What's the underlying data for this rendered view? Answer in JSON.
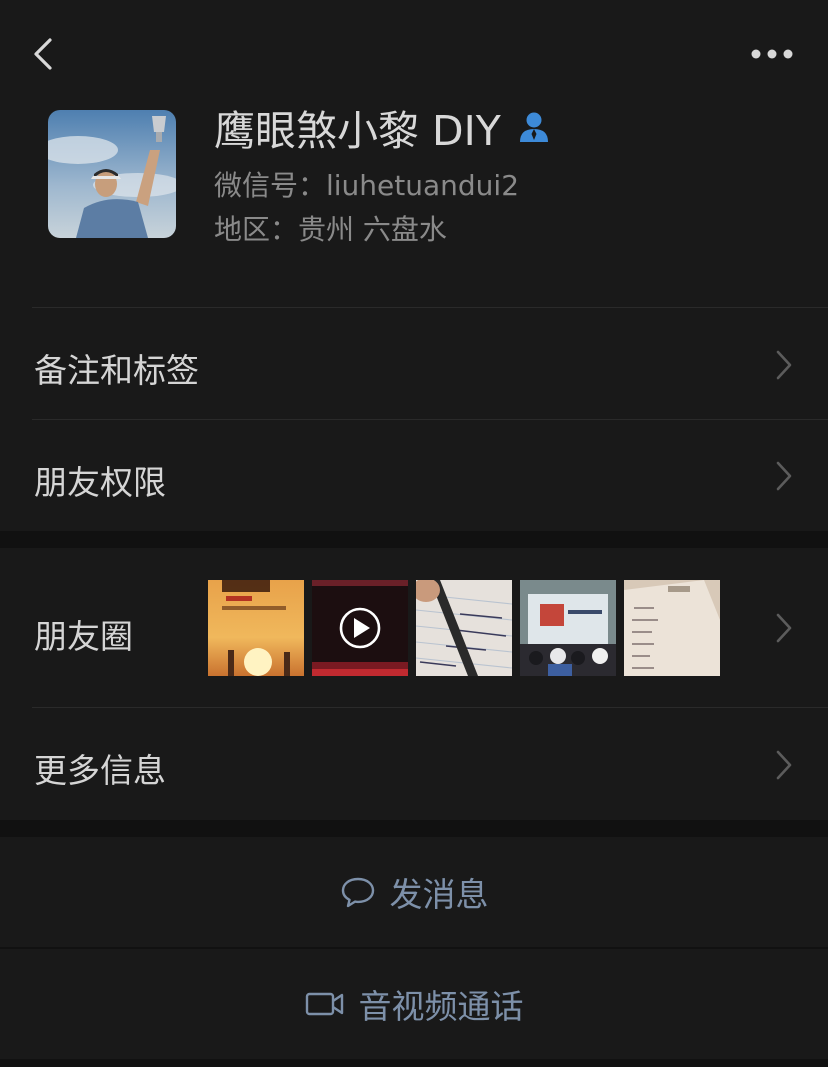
{
  "nav": {
    "back_icon": "chevron-left-icon",
    "more_icon": "more-dots-icon"
  },
  "profile": {
    "name": "鹰眼煞小黎 DIY",
    "wechat_id": "微信号：liuhetuandui2",
    "region": "地区：贵州 六盘水",
    "badge_icon": "person-icon"
  },
  "menu": {
    "remarks_tags": "备注和标签",
    "friend_permissions": "朋友权限",
    "moments": "朋友圈",
    "more_info": "更多信息"
  },
  "actions": {
    "send_message": "发消息",
    "av_call": "音视频通话"
  },
  "colors": {
    "background": "#111111",
    "cell": "#191919",
    "primary_text": "#d5d5d5",
    "secondary_text": "#8a8a8a",
    "action_text": "#7d90a9",
    "badge": "#3d8ad8"
  }
}
